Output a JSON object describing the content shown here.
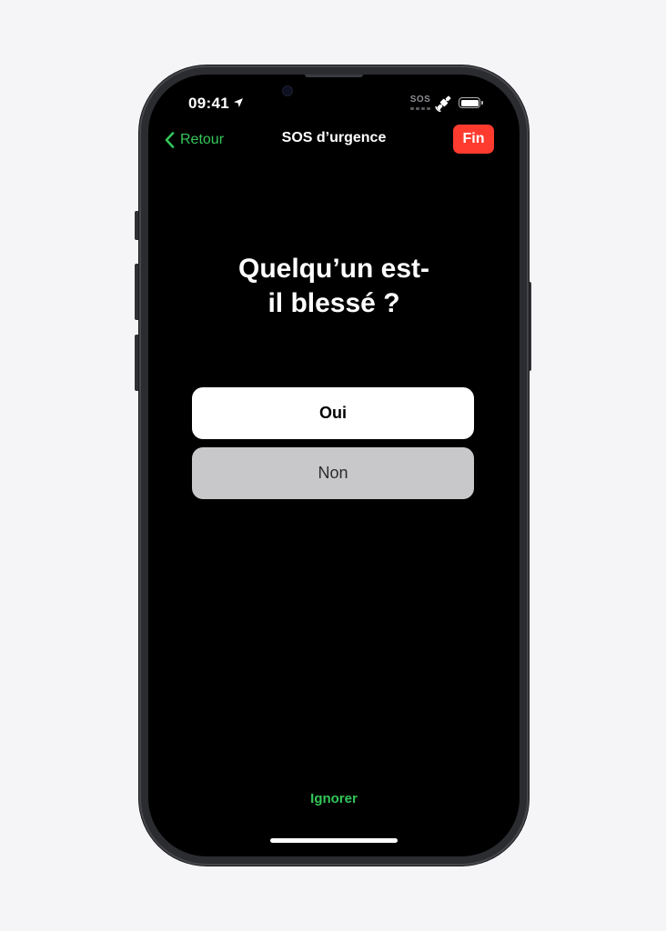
{
  "status_bar": {
    "time": "09:41",
    "sos_indicator": "SOS",
    "icons": [
      "location-arrow-icon",
      "satellite-icon",
      "battery-icon"
    ]
  },
  "nav": {
    "back_label": "Retour",
    "title": "SOS d’urgence",
    "end_label": "Fin"
  },
  "question": "Quelqu’un est-\nil blessé ?",
  "choices": {
    "yes": "Oui",
    "no": "Non"
  },
  "skip_label": "Ignorer",
  "colors": {
    "accent_green": "#33c759",
    "end_red": "#ff3b30",
    "screen_background": "#000000"
  }
}
